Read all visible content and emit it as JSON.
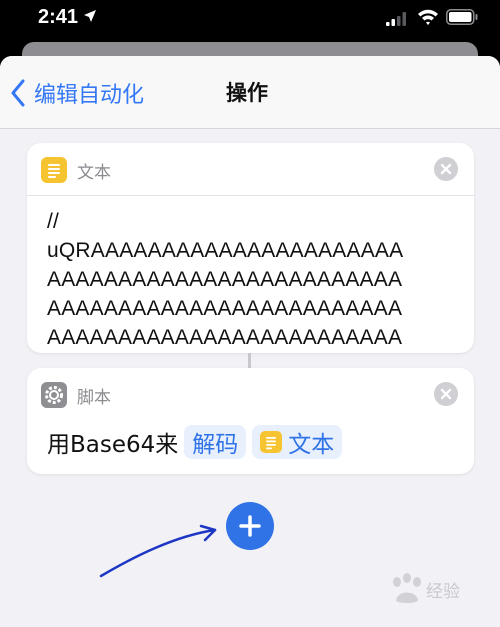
{
  "status_bar": {
    "time": "2:41",
    "icons": [
      "location-arrow-icon",
      "signal-icon",
      "wifi-icon",
      "battery-icon"
    ]
  },
  "nav": {
    "back_label": "编辑自动化",
    "title": "操作"
  },
  "text_action": {
    "header": "文本",
    "icon": "text-lines-icon",
    "content": "//\nuQRAAAAAAAAAAAAAAAAAAAAAA\nAAAAAAAAAAAAAAAAAAAAAAAAA\nAAAAAAAAAAAAAAAAAAAAAAAAA\nAAAAAAAAAAAAAAAAAAAAAAAAA"
  },
  "script_action": {
    "header": "脚本",
    "icon": "gear-icon",
    "phrase_prefix": "用Base64来",
    "mode_token": "解码",
    "input_token": "文本"
  },
  "add_button": {
    "icon": "plus-icon"
  },
  "watermark": {
    "text": "经验",
    "icon": "baidu-paw-icon"
  },
  "colors": {
    "accent": "#2f73e6",
    "token_bg": "#e8f0fd",
    "text_icon": "#f6c431",
    "script_icon": "#8e8e93",
    "sheet_bg": "#f1f1f6"
  }
}
